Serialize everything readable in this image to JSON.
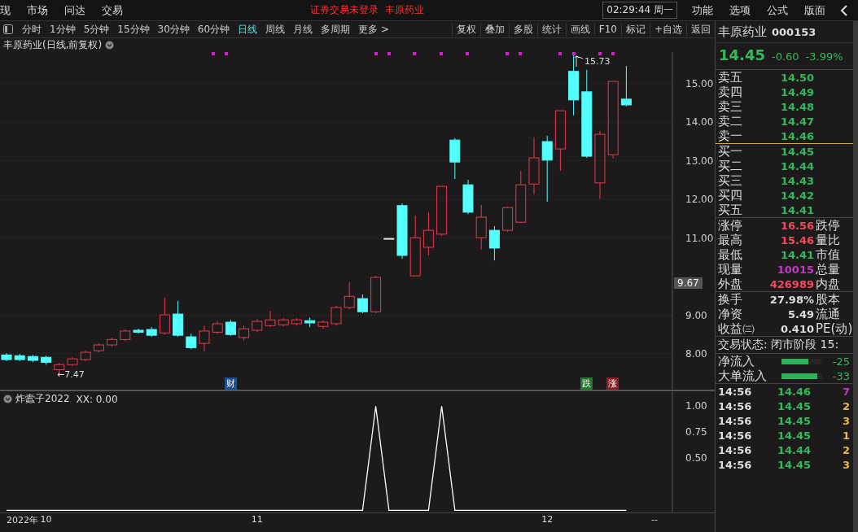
{
  "menu": [
    {
      "label": "现"
    },
    {
      "label": "市场"
    },
    {
      "label": "问达"
    },
    {
      "label": "交易"
    }
  ],
  "notice": {
    "status": "证券交易未登录",
    "stock": "丰原药业"
  },
  "clock": "02:29:44 周一",
  "right_menu": [
    {
      "label": "功能"
    },
    {
      "label": "选项"
    },
    {
      "label": "公式"
    },
    {
      "label": "版面"
    }
  ],
  "periods": [
    {
      "label": "分时",
      "selected": false
    },
    {
      "label": "1分钟",
      "selected": false
    },
    {
      "label": "5分钟",
      "selected": false
    },
    {
      "label": "15分钟",
      "selected": false
    },
    {
      "label": "30分钟",
      "selected": false
    },
    {
      "label": "60分钟",
      "selected": false
    },
    {
      "label": "日线",
      "selected": true
    },
    {
      "label": "周线",
      "selected": false
    },
    {
      "label": "月线",
      "selected": false
    },
    {
      "label": "多周期",
      "selected": false
    },
    {
      "label": "更多 >",
      "selected": false
    }
  ],
  "tools": [
    "复权",
    "叠加",
    "多股",
    "统计",
    "画线",
    "F10",
    "标记",
    "+自选",
    "返回"
  ],
  "chart_title": "丰原药业(日线,前复权)",
  "price_chart": {
    "chart_data": {
      "type": "candlestick",
      "ylim": [
        7.05,
        15.82
      ],
      "grid": true,
      "categories": [
        null,
        null,
        null,
        null,
        null,
        null,
        null,
        null,
        null,
        null,
        null,
        null,
        null,
        null,
        null,
        null,
        null,
        null,
        null,
        null,
        null,
        null,
        null,
        null,
        null,
        null,
        null,
        null,
        null,
        null,
        null,
        null,
        null,
        null,
        null,
        null,
        null,
        null,
        null,
        null,
        null,
        null,
        null,
        null,
        null,
        null,
        null,
        null
      ],
      "yticks": [
        {
          "value": 15,
          "label": "15.00"
        },
        {
          "value": 14,
          "label": "14.00"
        },
        {
          "value": 13,
          "label": "13.00"
        },
        {
          "value": 12,
          "label": "12.00"
        },
        {
          "value": 11,
          "label": "11.00"
        },
        {
          "value": 9,
          "label": "9.00"
        },
        {
          "value": 8,
          "label": "8.00"
        }
      ],
      "ohlc": [
        [
          7.97,
          8.02,
          7.81,
          7.85
        ],
        [
          7.95,
          8.0,
          7.81,
          7.85
        ],
        [
          7.93,
          7.97,
          7.78,
          7.83
        ],
        [
          7.91,
          7.95,
          7.72,
          7.78
        ],
        [
          7.59,
          7.76,
          7.47,
          7.72
        ],
        [
          7.72,
          7.91,
          7.68,
          7.87
        ],
        [
          7.85,
          8.08,
          7.81,
          8.04
        ],
        [
          8.08,
          8.27,
          8.04,
          8.23
        ],
        [
          8.23,
          8.42,
          8.18,
          8.37
        ],
        [
          8.37,
          8.63,
          8.33,
          8.59
        ],
        [
          8.61,
          8.65,
          8.52,
          8.56
        ],
        [
          8.63,
          8.69,
          8.44,
          8.48
        ],
        [
          8.54,
          9.45,
          8.5,
          9.01
        ],
        [
          9.03,
          9.37,
          8.44,
          8.48
        ],
        [
          8.44,
          8.52,
          8.12,
          8.16
        ],
        [
          8.27,
          8.73,
          8.06,
          8.59
        ],
        [
          8.56,
          8.84,
          8.52,
          8.78
        ],
        [
          8.82,
          8.88,
          8.46,
          8.5
        ],
        [
          8.42,
          8.73,
          8.35,
          8.65
        ],
        [
          8.61,
          8.9,
          8.56,
          8.84
        ],
        [
          8.73,
          9.11,
          8.69,
          8.88
        ],
        [
          8.75,
          8.92,
          8.71,
          8.88
        ],
        [
          8.78,
          8.92,
          8.73,
          8.88
        ],
        [
          8.86,
          8.94,
          8.69,
          8.8
        ],
        [
          8.71,
          8.86,
          8.65,
          8.82
        ],
        [
          8.78,
          9.24,
          8.73,
          9.2
        ],
        [
          9.2,
          9.85,
          9.16,
          9.49
        ],
        [
          9.43,
          9.54,
          9.05,
          9.09
        ],
        [
          9.09,
          10.02,
          9.05,
          9.98
        ],
        [
          10.99,
          10.99,
          10.99,
          10.99
        ],
        [
          11.84,
          11.9,
          10.46,
          10.55
        ],
        [
          10.02,
          11.58,
          10.0,
          11.01
        ],
        [
          10.76,
          11.67,
          10.55,
          11.2
        ],
        [
          11.1,
          12.34,
          11.05,
          12.34
        ],
        [
          13.54,
          13.59,
          12.53,
          12.97
        ],
        [
          12.38,
          12.51,
          11.62,
          11.67
        ],
        [
          11.01,
          11.86,
          10.7,
          11.54
        ],
        [
          11.2,
          11.31,
          10.42,
          10.74
        ],
        [
          11.2,
          11.81,
          11.16,
          11.79
        ],
        [
          11.41,
          12.74,
          11.39,
          12.38
        ],
        [
          12.4,
          13.61,
          12.13,
          13.08
        ],
        [
          13.5,
          13.65,
          11.94,
          13.02
        ],
        [
          13.31,
          14.3,
          12.74,
          14.3
        ],
        [
          15.32,
          15.73,
          14.18,
          14.58
        ],
        [
          14.79,
          15.36,
          13.08,
          13.12
        ],
        [
          12.43,
          13.78,
          12.02,
          13.69
        ],
        [
          13.16,
          15.06,
          13.06,
          15.06
        ],
        [
          14.6,
          15.46,
          14.41,
          14.45
        ]
      ]
    }
  },
  "current_price_tag": "9.67",
  "low_label": "←7.47",
  "high_label": "15.73",
  "events": [
    {
      "label": "财",
      "kind": "finance"
    },
    {
      "label": "跌",
      "kind": "down"
    },
    {
      "label": "涨",
      "kind": "up"
    }
  ],
  "indicator": {
    "name": "炸蠹子2022",
    "reading": ": 0.00",
    "chart_data": {
      "type": "line",
      "ylim": [
        -0.02,
        1.15
      ],
      "categories": [
        null,
        null,
        null,
        "10",
        null,
        null,
        null,
        null,
        null,
        null,
        null,
        null,
        null,
        null,
        null,
        null,
        null,
        null,
        null,
        "11",
        null,
        null,
        null,
        null,
        null,
        null,
        null,
        null,
        null,
        null,
        null,
        null,
        null,
        null,
        null,
        null,
        null,
        null,
        null,
        null,
        null,
        "12",
        null,
        null,
        null,
        null,
        null,
        null
      ],
      "yticks": [
        {
          "value": 0.5,
          "label": "0.50"
        },
        {
          "value": 0.75,
          "label": "0.75"
        },
        {
          "value": 1,
          "label": "1.00"
        }
      ],
      "series": [
        {
          "name": "XX",
          "color": "#ffffff",
          "values": [
            0,
            0,
            0,
            0,
            0,
            0,
            0,
            0,
            0,
            0,
            0,
            0,
            0,
            0,
            0,
            0,
            0,
            0,
            0,
            0,
            0,
            0,
            0,
            0,
            0,
            0,
            0,
            0,
            1,
            0,
            0,
            0,
            0,
            1,
            0,
            0,
            0,
            0,
            0,
            0,
            0,
            0,
            0,
            0,
            0,
            0,
            0,
            0
          ]
        }
      ]
    }
  },
  "date_axis": [
    "2022年",
    "--"
  ],
  "quote": {
    "name": "丰原药业",
    "code": "000153",
    "price": "14.45",
    "change": "-0.60",
    "pct": "-3.99%"
  },
  "asks": [
    {
      "label": "卖五",
      "price": "14.50"
    },
    {
      "label": "卖四",
      "price": "14.49"
    },
    {
      "label": "卖三",
      "price": "14.48"
    },
    {
      "label": "卖二",
      "price": "14.47"
    },
    {
      "label": "卖一",
      "price": "14.46"
    }
  ],
  "bids": [
    {
      "label": "买一",
      "price": "14.45"
    },
    {
      "label": "买二",
      "price": "14.44"
    },
    {
      "label": "买三",
      "price": "14.43"
    },
    {
      "label": "买四",
      "price": "14.42"
    },
    {
      "label": "买五",
      "price": "14.41"
    }
  ],
  "stats": [
    {
      "label": "涨停",
      "value": "16.56",
      "color": "#f04a5e",
      "label2": "跌停"
    },
    {
      "label": "最高",
      "value": "15.46",
      "color": "#f04a5e",
      "label2": "量比"
    },
    {
      "label": "最低",
      "value": "14.41",
      "color": "#34b85e",
      "label2": "市值"
    },
    {
      "label": "现量",
      "value": "10015",
      "color": "#c838c8",
      "label2": "总量"
    },
    {
      "label": "外盘",
      "value": "426989",
      "color": "#f04a5e",
      "label2": "内盘"
    }
  ],
  "fundamentals": [
    {
      "label": "换手",
      "value": "27.98%",
      "label2": "股本"
    },
    {
      "label": "净资",
      "value": "5.49",
      "label2": "流通"
    },
    {
      "label": "收益㈢",
      "value": "0.410",
      "label2": "PE(动)"
    }
  ],
  "trade_status": "交易状态: 闭市阶段 15:",
  "flows": [
    {
      "label": "净流入",
      "value": "-25",
      "level": 0.66
    },
    {
      "label": "大单流入",
      "value": "-33",
      "level": 0.88
    }
  ],
  "ticks": [
    {
      "time": "14:56",
      "price": "14.46",
      "volume": "7",
      "color": "#c838c8"
    },
    {
      "time": "14:56",
      "price": "14.45",
      "volume": "2",
      "color": "#e8b84a"
    },
    {
      "time": "14:56",
      "price": "14.45",
      "volume": "3",
      "color": "#e8b84a"
    },
    {
      "time": "14:56",
      "price": "14.45",
      "volume": "1",
      "color": "#e8b84a"
    },
    {
      "time": "14:56",
      "price": "14.44",
      "volume": "2",
      "color": "#e8b84a"
    },
    {
      "time": "14:56",
      "price": "14.45",
      "volume": "3",
      "color": "#e8b84a"
    }
  ]
}
